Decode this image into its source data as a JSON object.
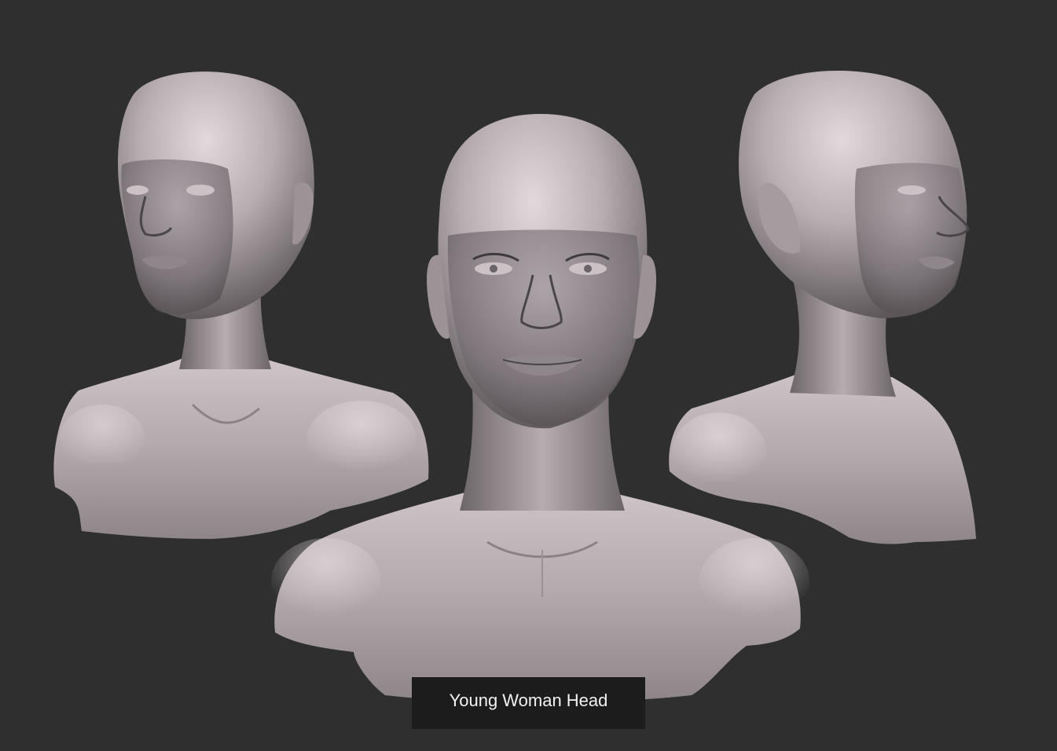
{
  "caption": {
    "text": "Young Woman Head"
  },
  "scene": {
    "subject": "three sculpted female bust renders",
    "views": [
      "three-quarter-left",
      "front",
      "three-quarter-right"
    ],
    "colors": {
      "background": "#2f2f2f",
      "caption_bg": "#1c1c1c",
      "caption_text": "#f2f2f2",
      "skin_light": "#d8cdd0",
      "skin_mid": "#a89ea2",
      "skin_dark": "#5b5558"
    }
  }
}
